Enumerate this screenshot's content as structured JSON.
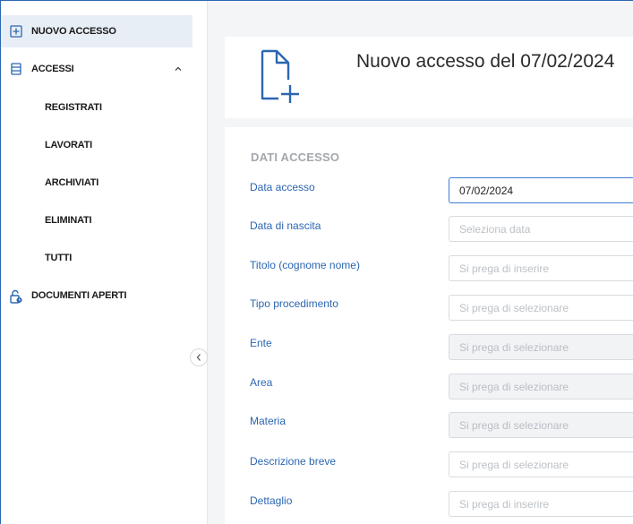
{
  "sidebar": {
    "nuovo_accesso": "NUOVO ACCESSO",
    "accessi": "ACCESSI",
    "sub_items": [
      "REGISTRATI",
      "LAVORATI",
      "ARCHIVIATI",
      "ELIMINATI",
      "TUTTI"
    ],
    "documenti_aperti": "DOCUMENTI APERTI"
  },
  "header": {
    "title": "Nuovo accesso del 07/02/2024"
  },
  "form": {
    "section_title": "DATI ACCESSO",
    "fields": [
      {
        "label": "Data accesso",
        "value": "07/02/2024"
      },
      {
        "label": "Data di nascita",
        "placeholder": "Seleziona data"
      },
      {
        "label": "Titolo (cognome nome)",
        "placeholder": "Si prega di inserire"
      },
      {
        "label": "Tipo procedimento",
        "placeholder": "Si prega di selezionare"
      },
      {
        "label": "Ente",
        "placeholder": "Si prega di selezionare"
      },
      {
        "label": "Area",
        "placeholder": "Si prega di selezionare"
      },
      {
        "label": "Materia",
        "placeholder": "Si prega di selezionare"
      },
      {
        "label": "Descrizione breve",
        "placeholder": "Si prega di selezionare"
      },
      {
        "label": "Dettaglio",
        "placeholder": "Si prega di inserire"
      }
    ]
  },
  "colors": {
    "accent": "#2b66b1",
    "active_bg": "#e8eef6",
    "label": "#2b66b1",
    "section_title": "#a3a8ae"
  },
  "icons": {
    "nuovo_accesso": "plus-square-icon",
    "accessi": "list-box-icon",
    "documenti_aperti": "unlock-clock-icon",
    "header": "new-file-icon",
    "collapse": "chevron-left-icon"
  }
}
